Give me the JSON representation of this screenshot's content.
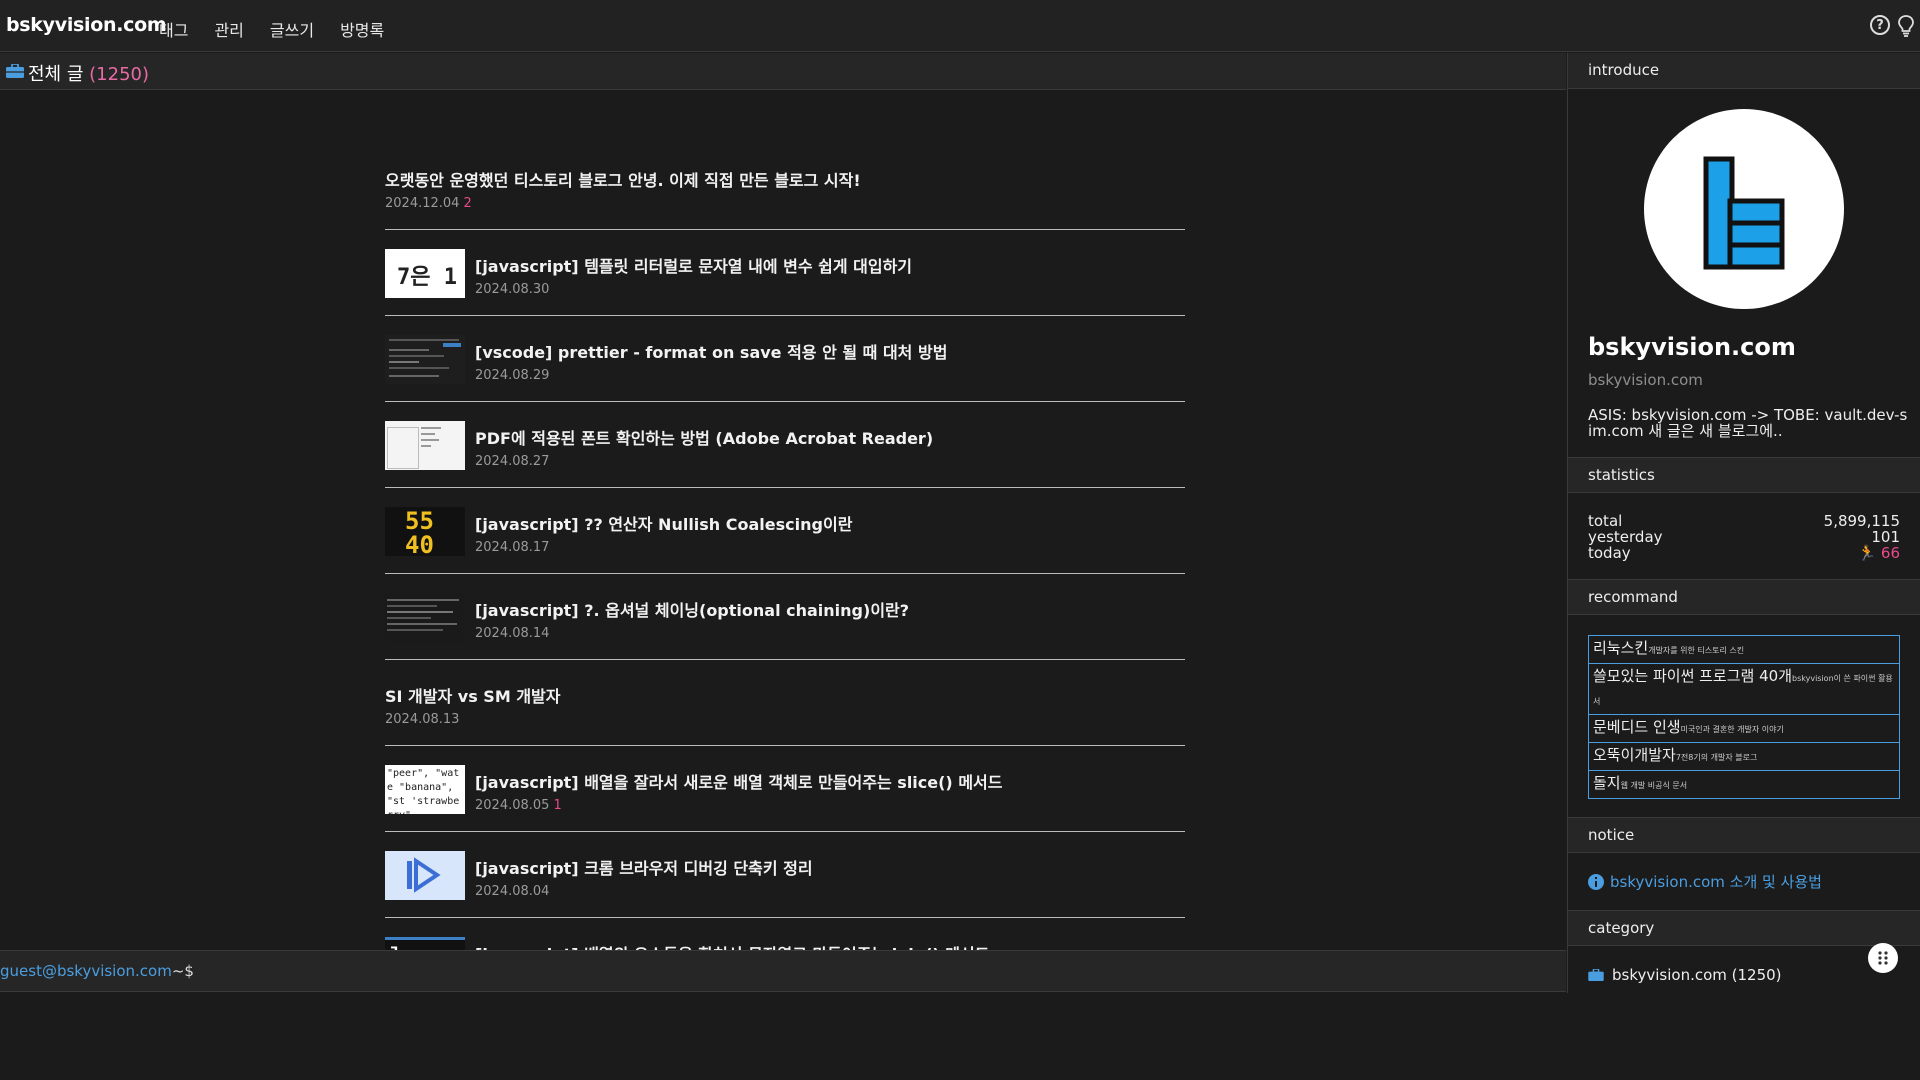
{
  "topbar": {
    "site_title": "bskyvision.com",
    "nav": [
      "태그",
      "관리",
      "글쓰기",
      "방명록"
    ],
    "icons": [
      "help-icon",
      "lightbulb-icon"
    ]
  },
  "main": {
    "header_title": "전체 글",
    "header_count": "(1250)",
    "posts": [
      {
        "title": "오랫동안 운영했던 티스토리 블로그 안녕. 이제 직접 만든 블로그 시작!",
        "date": "2024.12.04",
        "comments": "2",
        "has_thumb": false
      },
      {
        "title": "[javascript] 템플릿 리터럴로 문자열 내에 변수 쉽게 대입하기",
        "date": "2024.08.30",
        "comments": "",
        "has_thumb": true,
        "thumb_text": "7은 1"
      },
      {
        "title": "[vscode] prettier - format on save 적용 안 될 때 대처 방법",
        "date": "2024.08.29",
        "comments": "",
        "has_thumb": true
      },
      {
        "title": "PDF에 적용된 폰트 확인하는 방법 (Adobe Acrobat Reader)",
        "date": "2024.08.27",
        "comments": "",
        "has_thumb": true
      },
      {
        "title": "[javascript] ?? 연산자 Nullish Coalescing이란",
        "date": "2024.08.17",
        "comments": "",
        "has_thumb": true,
        "thumb_text": "55 40"
      },
      {
        "title": "[javascript] ?. 옵셔널 체이닝(optional chaining)이란?",
        "date": "2024.08.14",
        "comments": "",
        "has_thumb": true
      },
      {
        "title": "SI 개발자 vs SM 개발자",
        "date": "2024.08.13",
        "comments": "",
        "has_thumb": false
      },
      {
        "title": "[javascript] 배열을 잘라서 새로운 배열 객체로 만들어주는 slice() 메서드",
        "date": "2024.08.05",
        "comments": "1",
        "has_thumb": true,
        "thumb_text": "\"peer\", \"wate \"banana\", \"st 'strawberry\","
      },
      {
        "title": "[javascript] 크롬 브라우저 디버깅 단축키 정리",
        "date": "2024.08.04",
        "comments": "",
        "has_thumb": true
      },
      {
        "title": "[javascript] 배열의 요소들을 합쳐서 문자열로 만들어주는 join() 메서드",
        "date": "",
        "comments": "",
        "has_thumb": true
      }
    ]
  },
  "terminal": {
    "user": "guest@bskyvision.com",
    "prompt": "~$"
  },
  "sidebar": {
    "introduce": {
      "heading": "introduce",
      "name": "bskyvision.com",
      "sub": "bskyvision.com",
      "desc": "ASIS: bskyvision.com -> TOBE: vault.dev-sim.com 새 글은 새 블로그에.."
    },
    "statistics": {
      "heading": "statistics",
      "total_label": "total",
      "total_value": "5,899,115",
      "yesterday_label": "yesterday",
      "yesterday_value": "101",
      "today_label": "today",
      "today_value": "66"
    },
    "recommand": {
      "heading": "recommand",
      "items": [
        {
          "name": "리눅스킨",
          "note": "개발자를 위한 티스토리 스킨"
        },
        {
          "name": "쓸모있는 파이썬 프로그램 40개",
          "note": "bskyvision이 쓴 파이썬 활용서"
        },
        {
          "name": "문베디드 인생",
          "note": "미국인과 결혼한 개발자 이야기"
        },
        {
          "name": "오뚝이개발자",
          "note": "7전8기의 개발자 블로그"
        },
        {
          "name": "돌지",
          "note": "웹 개발 비공식 문서"
        }
      ]
    },
    "notice": {
      "heading": "notice",
      "link": "bskyvision.com 소개 및 사용법"
    },
    "category": {
      "heading": "category",
      "item": "bskyvision.com (1250)"
    }
  },
  "colors": {
    "accent_blue": "#4a9ee0",
    "pink": "#e84a8a",
    "logo_blue": "#1ca0e8"
  }
}
